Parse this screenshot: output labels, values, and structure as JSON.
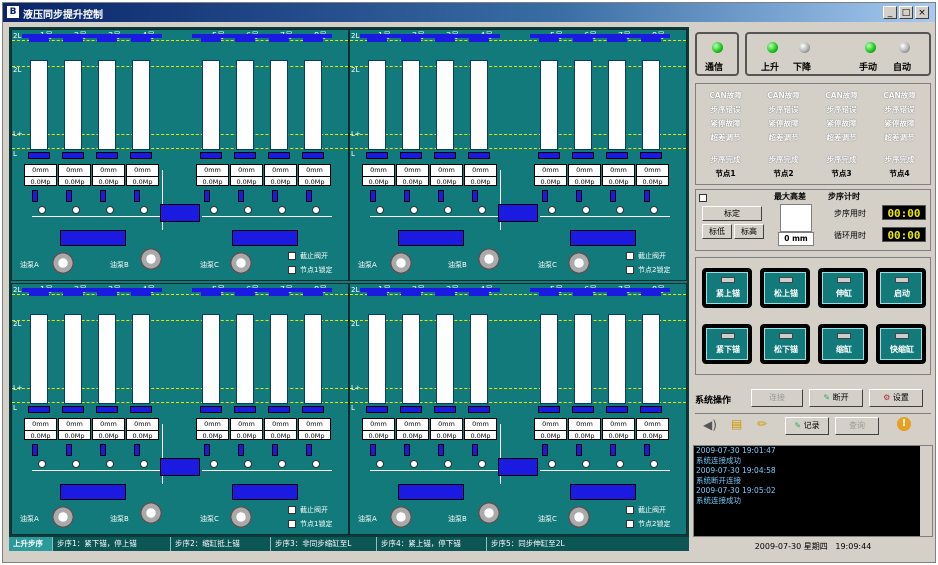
{
  "window": {
    "title": "液压同步提升控制"
  },
  "plot": {
    "top_labels": [
      "1号",
      "2号",
      "3号",
      "4号",
      "5号",
      "6号",
      "7号",
      "8号"
    ],
    "side_labels": [
      "2L",
      "2L",
      "L+",
      "L"
    ],
    "readout_mm": "0mm",
    "readout_mp": "0.0Mp",
    "pumps": [
      {
        "a": "油泵A",
        "b": "油泵B",
        "c": "油泵C"
      },
      {
        "a": "油泵A",
        "b": "油泵B",
        "c": "油泵C"
      },
      {
        "a": "油泵A",
        "b": "油泵B",
        "c": "油泵C"
      },
      {
        "a": "油泵A",
        "b": "油泵B",
        "c": "油泵C"
      }
    ],
    "check_stop": "截止阀开",
    "check_node": "节点1锁定",
    "check_node_b": "节点2锁定"
  },
  "tabs": [
    "上升步序",
    "步序1：紧下锚，停上锚",
    "步序2：缩缸抵上锚",
    "步序3：非同步缩缸至L",
    "步序4：紧上锚，停下锚",
    "步序5：同步伸缸至2L"
  ],
  "status": {
    "comm": "通信",
    "up": "上升",
    "down": "下降",
    "manual": "手动",
    "auto": "自动"
  },
  "nodes": [
    {
      "can": "CAN故障",
      "step_err": "步序错误",
      "estop": "紧停故障",
      "dev": "超差调节",
      "done": "步序完成",
      "name": "节点1"
    },
    {
      "can": "CAN故障",
      "step_err": "步序错误",
      "estop": "紧停故障",
      "dev": "超差调节",
      "done": "步序完成",
      "name": "节点2"
    },
    {
      "can": "CAN故障",
      "step_err": "步序错误",
      "estop": "紧停故障",
      "dev": "超差调节",
      "done": "步序完成",
      "name": "节点3"
    },
    {
      "can": "CAN故障",
      "step_err": "步序错误",
      "estop": "紧停故障",
      "dev": "超差调节",
      "done": "步序完成",
      "name": "节点4"
    }
  ],
  "calib": {
    "calibrate": "标定",
    "low": "标低",
    "high": "标高"
  },
  "maxdiff": {
    "title": "最大高差",
    "value": "0 mm"
  },
  "timer": {
    "title": "步序计时",
    "step_label": "步序用时",
    "step_value": "00:00",
    "cycle_label": "循环用时",
    "cycle_value": "00:00"
  },
  "big_buttons": [
    "紧上锚",
    "松上锚",
    "伸缸",
    "启动",
    "紧下锚",
    "松下锚",
    "缩缸",
    "快缩缸"
  ],
  "sysop": {
    "title": "系统操作",
    "connect": "连接",
    "disconnect": "断开",
    "settings": "设置",
    "record": "记录",
    "query": "查询"
  },
  "log": [
    "2009-07-30 19:01:47",
    "系统连接成功",
    "2009-07-30 19:04:58",
    "系统断开连接",
    "2009-07-30 19:05:02",
    "系统连接成功"
  ],
  "statusbar": {
    "date": "2009-07-30",
    "weekday": "星期四",
    "time": "19:09:44"
  },
  "colors": {
    "panel_teal": "#127a7a",
    "actuator_blue": "#1a1ae0",
    "led_green": "#16c016",
    "lcd_yellow": "#e8e800"
  }
}
